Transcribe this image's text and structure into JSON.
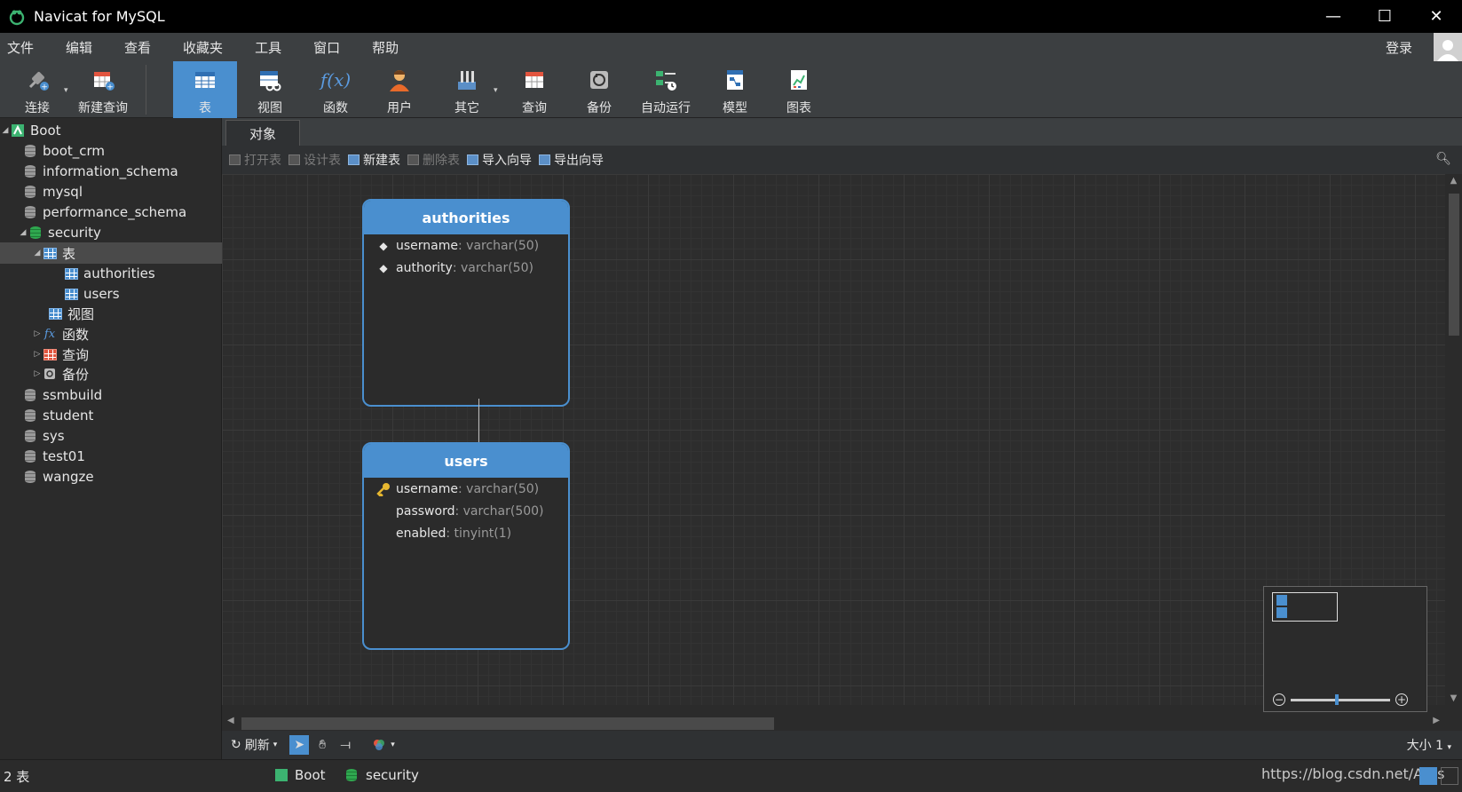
{
  "window": {
    "title": "Navicat for MySQL",
    "min": "—",
    "max": "☐",
    "close": "✕"
  },
  "menu": {
    "items": [
      "文件",
      "编辑",
      "查看",
      "收藏夹",
      "工具",
      "窗口",
      "帮助"
    ],
    "login": "登录"
  },
  "toolbar": {
    "buttons": [
      {
        "label": "连接",
        "icon": "plug-icon"
      },
      {
        "label": "新建查询",
        "icon": "new-query-icon"
      },
      {
        "label": "表",
        "icon": "table-icon"
      },
      {
        "label": "视图",
        "icon": "view-icon"
      },
      {
        "label": "函数",
        "icon": "function-icon"
      },
      {
        "label": "用户",
        "icon": "user-icon"
      },
      {
        "label": "其它",
        "icon": "other-icon"
      },
      {
        "label": "查询",
        "icon": "query-icon"
      },
      {
        "label": "备份",
        "icon": "backup-icon"
      },
      {
        "label": "自动运行",
        "icon": "schedule-icon"
      },
      {
        "label": "模型",
        "icon": "model-icon"
      },
      {
        "label": "图表",
        "icon": "chart-icon"
      }
    ],
    "active": "表",
    "fx_glyph": "f(x)"
  },
  "tree": {
    "connection": "Boot",
    "databases": [
      "boot_crm",
      "information_schema",
      "mysql",
      "performance_schema",
      "security",
      "ssmbuild",
      "student",
      "sys",
      "test01",
      "wangze"
    ],
    "security_children": {
      "tables_label": "表",
      "tables": [
        "authorities",
        "users"
      ],
      "views_label": "视图",
      "functions_label": "函数",
      "queries_label": "查询",
      "backups_label": "备份"
    }
  },
  "tabs": {
    "objects": "对象"
  },
  "object_toolbar": {
    "open": "打开表",
    "design": "设计表",
    "new": "新建表",
    "delete": "删除表",
    "import": "导入向导",
    "export": "导出向导"
  },
  "entities": [
    {
      "name": "authorities",
      "fields": [
        {
          "name": "username",
          "type": ": varchar(50)",
          "marker": "◆"
        },
        {
          "name": "authority",
          "type": ": varchar(50)",
          "marker": "◆"
        }
      ]
    },
    {
      "name": "users",
      "fields": [
        {
          "name": "username",
          "type": ": varchar(50)",
          "marker": "key"
        },
        {
          "name": "password",
          "type": ": varchar(500)",
          "marker": ""
        },
        {
          "name": "enabled",
          "type": ": tinyint(1)",
          "marker": ""
        }
      ]
    }
  ],
  "canvas_bar": {
    "refresh": "刷新",
    "size": "大小 1"
  },
  "status": {
    "count": "2 表",
    "connection": "Boot",
    "database": "security",
    "watermark": "https://blog.csdn.net/Ares"
  },
  "colors": {
    "accent": "#4a8fcf",
    "background": "#2b2b2b",
    "green": "#2fa84f"
  }
}
